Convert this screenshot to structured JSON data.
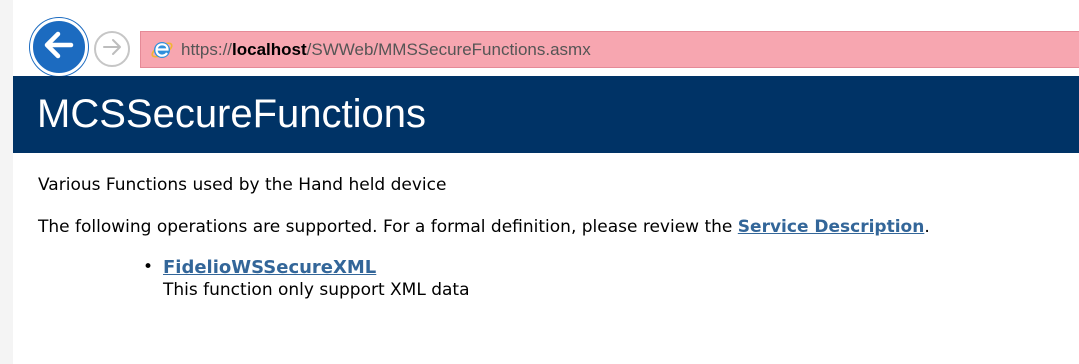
{
  "browser": {
    "url_prefix": "https://",
    "url_host": "localhost",
    "url_path": "/SWWeb/MMSSecureFunctions.asmx"
  },
  "page": {
    "title": "MCSSecureFunctions",
    "description": "Various Functions used by the Hand held device",
    "ops_intro": "The following operations are supported. For a formal definition, please review the ",
    "service_description_link": "Service Description",
    "ops_intro_end": ".",
    "operations": [
      {
        "name": "FidelioWSSecureXML",
        "description": "This function only support XML data"
      }
    ]
  },
  "colors": {
    "header_bg": "#003366",
    "address_bar_bg": "#f7a6b0",
    "link": "#336699",
    "back_button": "#1c6bc0"
  },
  "icons": {
    "back": "back-arrow-icon",
    "forward": "forward-arrow-icon",
    "browser": "internet-explorer-icon"
  }
}
